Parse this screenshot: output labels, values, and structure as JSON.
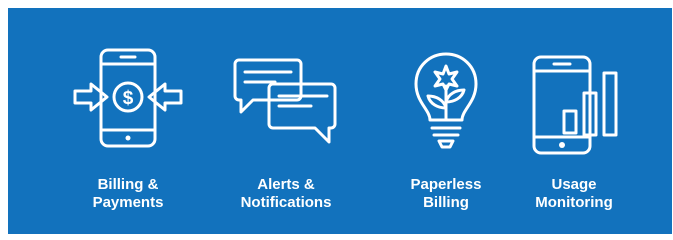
{
  "banner": {
    "background_color": "#1272BD",
    "foreground_color": "#FFFFFF",
    "features": [
      {
        "label": "Billing &\nPayments",
        "icon": "phone-dollar-arrows-icon"
      },
      {
        "label": "Alerts &\nNotifications",
        "icon": "chat-bubbles-icon"
      },
      {
        "label": "Paperless\nBilling",
        "icon": "lightbulb-plant-icon"
      },
      {
        "label": "Usage\nMonitoring",
        "icon": "phone-bar-chart-icon"
      }
    ]
  }
}
